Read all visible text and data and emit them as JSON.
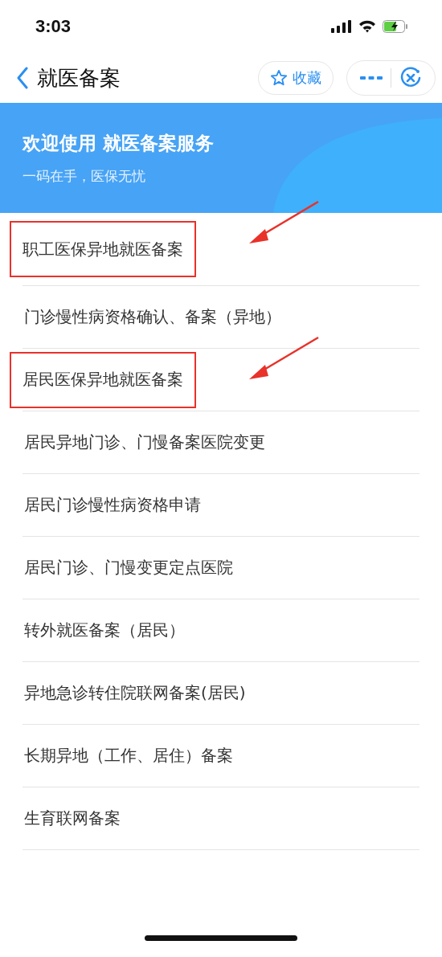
{
  "status_bar": {
    "time": "3:03"
  },
  "nav": {
    "title": "就医备案",
    "favorite_label": "收藏"
  },
  "banner": {
    "title": "欢迎使用 就医备案服务",
    "subtitle": "一码在手，医保无忧"
  },
  "items": [
    {
      "label": "职工医保异地就医备案",
      "highlighted": true
    },
    {
      "label": "门诊慢性病资格确认、备案（异地）",
      "highlighted": false
    },
    {
      "label": "居民医保异地就医备案",
      "highlighted": true
    },
    {
      "label": "居民异地门诊、门慢备案医院变更",
      "highlighted": false
    },
    {
      "label": "居民门诊慢性病资格申请",
      "highlighted": false
    },
    {
      "label": "居民门诊、门慢变更定点医院",
      "highlighted": false
    },
    {
      "label": "转外就医备案（居民）",
      "highlighted": false
    },
    {
      "label": "异地急诊转住院联网备案(居民)",
      "highlighted": false
    },
    {
      "label": "长期异地（工作、居住）备案",
      "highlighted": false
    },
    {
      "label": "生育联网备案",
      "highlighted": false
    }
  ]
}
